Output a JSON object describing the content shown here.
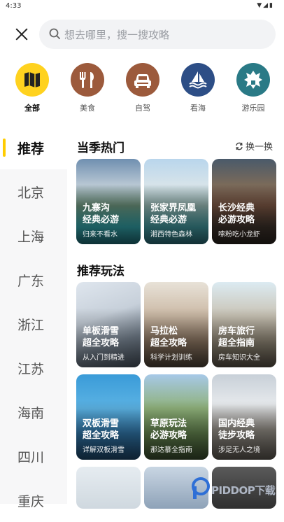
{
  "status_bar": {
    "time": "4:33",
    "icons": "▼◢▮"
  },
  "search": {
    "placeholder": "想去哪里，搜一搜攻略"
  },
  "categories": [
    {
      "label": "全部",
      "icon": "map-icon",
      "color": "#ffd21f"
    },
    {
      "label": "美食",
      "icon": "fork-knife-icon",
      "color": "#9c5a3c"
    },
    {
      "label": "自驾",
      "icon": "car-icon",
      "color": "#9c5a3c"
    },
    {
      "label": "看海",
      "icon": "sailboat-icon",
      "color": "#2d4e86"
    },
    {
      "label": "游乐园",
      "icon": "castle-icon",
      "color": "#2a7a86"
    }
  ],
  "regions": [
    "推荐",
    "北京",
    "上海",
    "广东",
    "浙江",
    "江苏",
    "海南",
    "四川",
    "重庆"
  ],
  "hot": {
    "title": "当季热门",
    "swap_label": "换一换",
    "cards": [
      {
        "title": "九寨沟\n经典必游",
        "subtitle": "归来不看水"
      },
      {
        "title": "张家界凤凰\n经典必游",
        "subtitle": "湘西特色森林"
      },
      {
        "title": "长沙经典\n必游攻略",
        "subtitle": "嗦粉吃小龙虾"
      }
    ]
  },
  "recommend": {
    "title": "推荐玩法",
    "cards": [
      {
        "title": "单板滑雪\n超全攻略",
        "subtitle": "从入门到精进"
      },
      {
        "title": "马拉松\n超全攻略",
        "subtitle": "科学计划训练"
      },
      {
        "title": "房车旅行\n超全指南",
        "subtitle": "房车知识大全"
      },
      {
        "title": "双板滑雪\n超全攻略",
        "subtitle": "详解双板滑雪"
      },
      {
        "title": "草原玩法\n必游攻略",
        "subtitle": "那达慕全指南"
      },
      {
        "title": "国内经典\n徒步攻略",
        "subtitle": "涉足无人之境"
      }
    ]
  },
  "watermark": {
    "text": "PIDDOP下载"
  },
  "colors": {
    "accent": "#ffcc00",
    "nav_bg": "#f7f7f8",
    "search_bg": "#f2f3f5"
  }
}
